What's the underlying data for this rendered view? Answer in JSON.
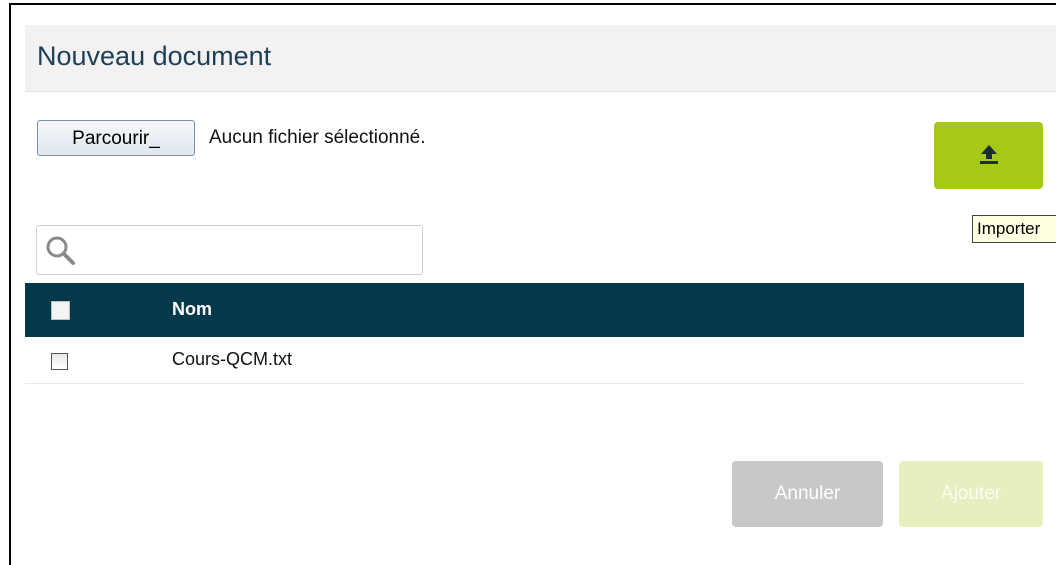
{
  "dialog": {
    "title": "Nouveau document"
  },
  "file_input": {
    "browse_label": "Parcourir_",
    "status": "Aucun fichier sélectionné."
  },
  "upload": {
    "icon": "upload-icon",
    "tooltip": "Importer"
  },
  "search": {
    "placeholder": "",
    "value": "",
    "icon": "search-icon"
  },
  "table": {
    "header": {
      "name": "Nom"
    },
    "rows": [
      {
        "name": "Cours-QCM.txt",
        "checked": false
      }
    ]
  },
  "footer": {
    "cancel_label": "Annuler",
    "add_label": "Ajouter"
  },
  "colors": {
    "header_bg": "#04394a",
    "accent": "#a6c818",
    "title": "#1e3f55"
  }
}
